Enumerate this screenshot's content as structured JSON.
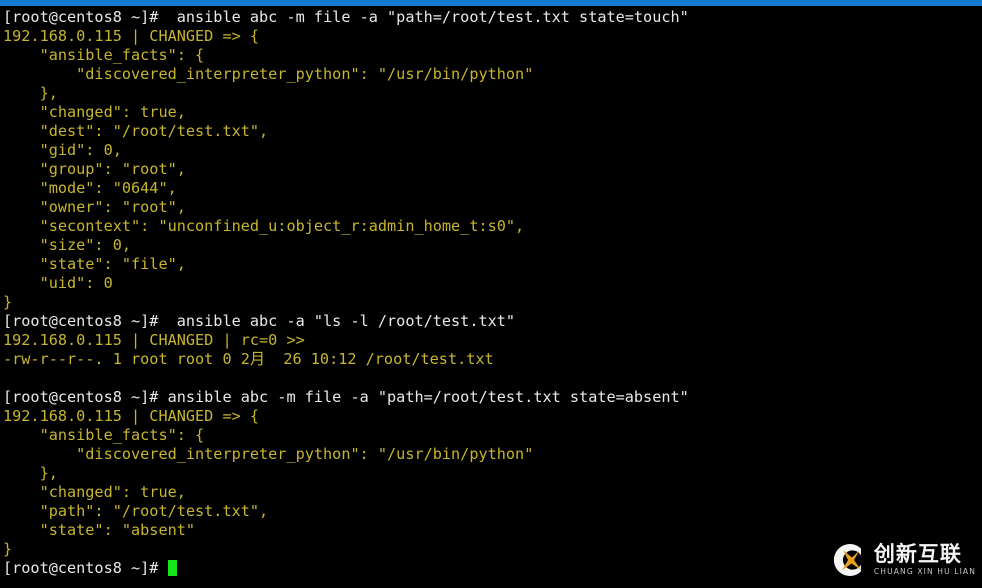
{
  "window": {
    "titlebar_color": "#1479d1",
    "background_color": "#000000",
    "prompt_color": "#e8e8e8",
    "output_color": "#c7b52e",
    "cursor_color": "#19e619"
  },
  "terminal": {
    "lines": [
      {
        "kind": "prompt",
        "text": "[root@centos8 ~]#  ansible abc -m file -a \"path=/root/test.txt state=touch\""
      },
      {
        "kind": "output",
        "text": "192.168.0.115 | CHANGED => {"
      },
      {
        "kind": "output",
        "text": "    \"ansible_facts\": {"
      },
      {
        "kind": "output",
        "text": "        \"discovered_interpreter_python\": \"/usr/bin/python\""
      },
      {
        "kind": "output",
        "text": "    },"
      },
      {
        "kind": "output",
        "text": "    \"changed\": true,"
      },
      {
        "kind": "output",
        "text": "    \"dest\": \"/root/test.txt\","
      },
      {
        "kind": "output",
        "text": "    \"gid\": 0,"
      },
      {
        "kind": "output",
        "text": "    \"group\": \"root\","
      },
      {
        "kind": "output",
        "text": "    \"mode\": \"0644\","
      },
      {
        "kind": "output",
        "text": "    \"owner\": \"root\","
      },
      {
        "kind": "output",
        "text": "    \"secontext\": \"unconfined_u:object_r:admin_home_t:s0\","
      },
      {
        "kind": "output",
        "text": "    \"size\": 0,"
      },
      {
        "kind": "output",
        "text": "    \"state\": \"file\","
      },
      {
        "kind": "output",
        "text": "    \"uid\": 0"
      },
      {
        "kind": "output",
        "text": "}"
      },
      {
        "kind": "prompt",
        "text": "[root@centos8 ~]#  ansible abc -a \"ls -l /root/test.txt\""
      },
      {
        "kind": "output",
        "text": "192.168.0.115 | CHANGED | rc=0 >>"
      },
      {
        "kind": "output",
        "text": "-rw-r--r--. 1 root root 0 2月  26 10:12 /root/test.txt"
      },
      {
        "kind": "blank",
        "text": " "
      },
      {
        "kind": "prompt",
        "text": "[root@centos8 ~]# ansible abc -m file -a \"path=/root/test.txt state=absent\""
      },
      {
        "kind": "output",
        "text": "192.168.0.115 | CHANGED => {"
      },
      {
        "kind": "output",
        "text": "    \"ansible_facts\": {"
      },
      {
        "kind": "output",
        "text": "        \"discovered_interpreter_python\": \"/usr/bin/python\""
      },
      {
        "kind": "output",
        "text": "    },"
      },
      {
        "kind": "output",
        "text": "    \"changed\": true,"
      },
      {
        "kind": "output",
        "text": "    \"path\": \"/root/test.txt\","
      },
      {
        "kind": "output",
        "text": "    \"state\": \"absent\""
      },
      {
        "kind": "output",
        "text": "}"
      }
    ],
    "final_prompt": "[root@centos8 ~]# "
  },
  "watermark": {
    "logo_name": "chuangxinhulian-logo-icon",
    "cn_text": "创新互联",
    "en_text": "CHUANG XIN HU LIAN",
    "ring_color": "#ffffff",
    "bolt_color": "#f0a81e"
  }
}
